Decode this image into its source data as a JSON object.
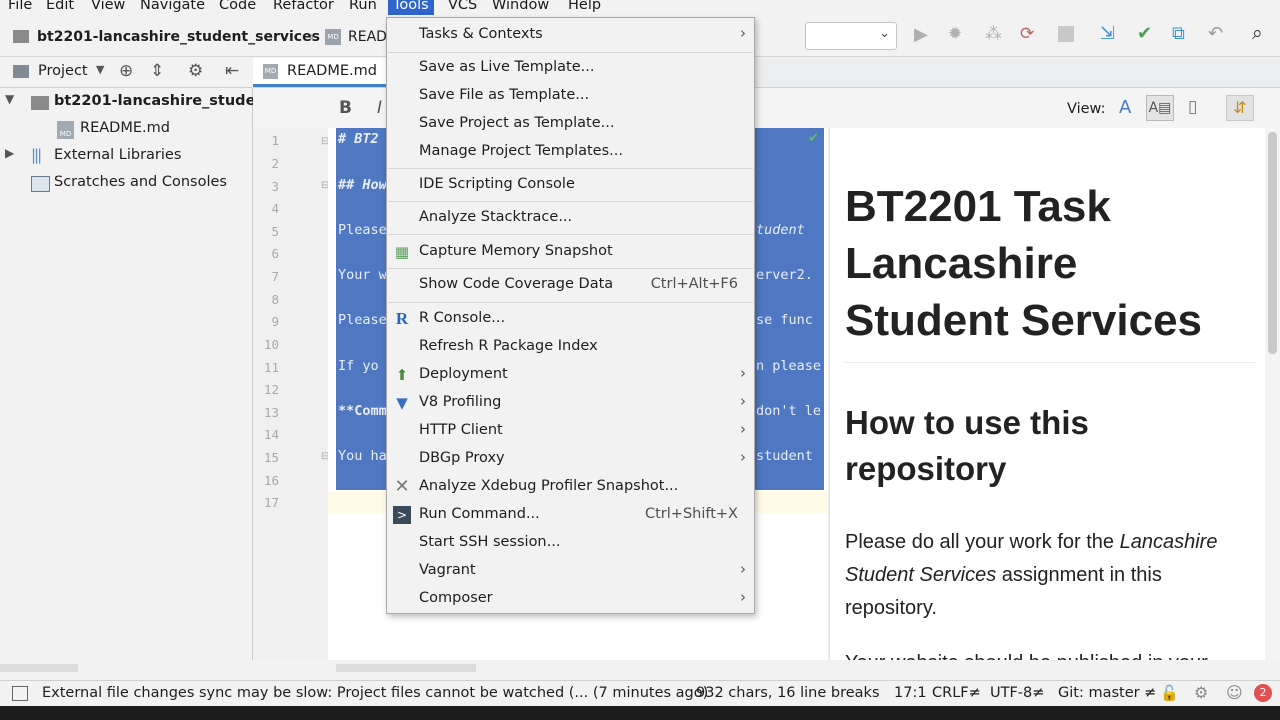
{
  "menubar": [
    "File",
    "Edit",
    "View",
    "Navigate",
    "Code",
    "Refactor",
    "Run",
    "Tools",
    "VCS",
    "Window",
    "Help"
  ],
  "breadcrumb": {
    "project": "bt2201-lancashire_student_services",
    "file": "READ"
  },
  "project_panel": {
    "title": "Project",
    "items": [
      {
        "label": "bt2201-lancashire_student",
        "badge": ""
      },
      {
        "label": "README.md",
        "badge": "MD"
      },
      {
        "label": "External Libraries",
        "badge": ""
      },
      {
        "label": "Scratches and Consoles",
        "badge": ""
      }
    ]
  },
  "editor": {
    "tab": "README.md",
    "toolbar": {
      "bold": "B",
      "italic": "I",
      "view_label": "View:",
      "view_a": "A"
    },
    "line_numbers": [
      "1",
      "2",
      "3",
      "4",
      "5",
      "6",
      "7",
      "8",
      "9",
      "10",
      "11",
      "12",
      "13",
      "14",
      "15",
      "16",
      "17"
    ],
    "code_left": [
      "# BT2",
      "",
      "## How",
      "",
      "Please",
      "",
      "Your w",
      "",
      "Please",
      "",
      "If yo",
      "",
      "**Comm",
      "",
      "You ha",
      "",
      ""
    ],
    "code_right": [
      "",
      "",
      "",
      "",
      "tudent",
      "",
      "erver2.",
      "",
      "se func",
      "",
      "n please",
      "",
      "don't le",
      "",
      "student",
      "",
      ""
    ]
  },
  "preview": {
    "h1": "BT2201 Task Lancashire Student Services",
    "h1_lines": [
      "BT2201 Task",
      "Lancashire",
      "Student Services"
    ],
    "h2_lines": [
      "How to use this",
      "repository"
    ],
    "p1_a": "Please do all your work for the ",
    "p1_em": "Lancashire",
    "p1_em2": "Student Services",
    "p1_b": " assignment in this",
    "p1_c": "repository.",
    "p2": "Your website should be published in your"
  },
  "tools_menu": [
    {
      "label": "Tasks & Contexts",
      "shortcut": "",
      "submenu": true,
      "icon": ""
    },
    {
      "sep": true
    },
    {
      "label": "Save as Live Template...",
      "shortcut": "",
      "submenu": false,
      "icon": ""
    },
    {
      "label": "Save File as Template...",
      "shortcut": "",
      "submenu": false,
      "icon": ""
    },
    {
      "label": "Save Project as Template...",
      "shortcut": "",
      "submenu": false,
      "icon": ""
    },
    {
      "label": "Manage Project Templates...",
      "shortcut": "",
      "submenu": false,
      "icon": ""
    },
    {
      "sep": true
    },
    {
      "label": "IDE Scripting Console",
      "shortcut": "",
      "submenu": false,
      "icon": ""
    },
    {
      "sep": true
    },
    {
      "label": "Analyze Stacktrace...",
      "shortcut": "",
      "submenu": false,
      "icon": ""
    },
    {
      "sep": true
    },
    {
      "label": "Capture Memory Snapshot",
      "shortcut": "",
      "submenu": false,
      "icon": "memory-snapshot-icon"
    },
    {
      "sep": true
    },
    {
      "label": "Show Code Coverage Data",
      "shortcut": "Ctrl+Alt+F6",
      "submenu": false,
      "icon": ""
    },
    {
      "sep": true
    },
    {
      "label": "R Console...",
      "shortcut": "",
      "submenu": false,
      "icon": "r-language-icon"
    },
    {
      "label": "Refresh R Package Index",
      "shortcut": "",
      "submenu": false,
      "icon": ""
    },
    {
      "label": "Deployment",
      "shortcut": "",
      "submenu": true,
      "icon": "deployment-icon"
    },
    {
      "label": "V8 Profiling",
      "shortcut": "",
      "submenu": true,
      "icon": "v8-icon"
    },
    {
      "label": "HTTP Client",
      "shortcut": "",
      "submenu": true,
      "icon": ""
    },
    {
      "label": "DBGp Proxy",
      "shortcut": "",
      "submenu": true,
      "icon": ""
    },
    {
      "label": "Analyze Xdebug Profiler Snapshot...",
      "shortcut": "",
      "submenu": false,
      "icon": "xdebug-icon"
    },
    {
      "label": "Run Command...",
      "shortcut": "Ctrl+Shift+X",
      "submenu": false,
      "icon": "terminal-icon"
    },
    {
      "label": "Start SSH session...",
      "shortcut": "",
      "submenu": false,
      "icon": ""
    },
    {
      "label": "Vagrant",
      "shortcut": "",
      "submenu": true,
      "icon": ""
    },
    {
      "label": "Composer",
      "shortcut": "",
      "submenu": true,
      "icon": ""
    }
  ],
  "statusbar": {
    "message": "External file changes sync may be slow: Project files cannot be watched (... (7 minutes ago)",
    "chars": "932 chars, 16 line breaks",
    "position": "17:1",
    "line_sep": "CRLF≠",
    "encoding": "UTF-8≠",
    "git": "Git: master ≠",
    "notifications": "2"
  },
  "colors": {
    "accent": "#2f65ca",
    "selection": "#4f77c2",
    "menu_bg": "#f2f2f2"
  }
}
